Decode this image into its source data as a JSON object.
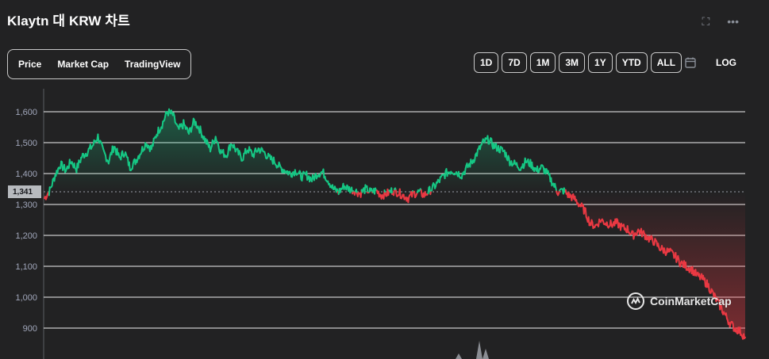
{
  "header": {
    "title": "Klaytn 대 KRW 차트",
    "fullscreen_icon": "expand-icon",
    "more_icon": "more-dots-icon"
  },
  "tabs": [
    {
      "label": "Price"
    },
    {
      "label": "Market Cap"
    },
    {
      "label": "TradingView"
    }
  ],
  "ranges": [
    "1D",
    "7D",
    "1M",
    "3M",
    "1Y",
    "YTD",
    "ALL"
  ],
  "calendar_icon": "calendar-icon",
  "log_label": "LOG",
  "current_price_label": "1,341",
  "watermark": "CoinMarketCap",
  "colors": {
    "up": "#16c784",
    "down": "#ea3943",
    "background": "#222223",
    "grid": "#ffffff"
  },
  "chart_data": {
    "type": "line",
    "title": "",
    "xlabel": "",
    "ylabel": "",
    "ylim": [
      850,
      1680
    ],
    "y_ticks": [
      900,
      1000,
      1100,
      1200,
      1300,
      1400,
      1500,
      1600
    ],
    "y_tick_labels": [
      "900",
      "1,000",
      "1,100",
      "1,200",
      "1,300",
      "1,400",
      "1,500",
      "1,600"
    ],
    "reference_price": 1341,
    "series": [
      {
        "values": [
          1320,
          1345,
          1395,
          1430,
          1410,
          1440,
          1415,
          1455,
          1470,
          1490,
          1520,
          1470,
          1440,
          1490,
          1450,
          1470,
          1420,
          1440,
          1470,
          1500,
          1480,
          1530,
          1560,
          1600,
          1590,
          1540,
          1560,
          1530,
          1570,
          1545,
          1510,
          1480,
          1520,
          1470,
          1460,
          1500,
          1470,
          1450,
          1480,
          1460,
          1480,
          1470,
          1450,
          1440,
          1420,
          1410,
          1400,
          1410,
          1390,
          1395,
          1380,
          1400,
          1405,
          1380,
          1350,
          1340,
          1360,
          1350,
          1345,
          1335,
          1350,
          1340,
          1345,
          1330,
          1335,
          1345,
          1340,
          1330,
          1320,
          1335,
          1340,
          1330,
          1345,
          1360,
          1380,
          1400,
          1410,
          1405,
          1395,
          1420,
          1440,
          1470,
          1500,
          1510,
          1490,
          1480,
          1470,
          1440,
          1430,
          1420,
          1440,
          1430,
          1410,
          1420,
          1400,
          1370,
          1340,
          1345,
          1330,
          1320,
          1300,
          1280,
          1240,
          1230,
          1250,
          1240,
          1235,
          1240,
          1225,
          1220,
          1200,
          1215,
          1205,
          1190,
          1180,
          1160,
          1150,
          1145,
          1130,
          1110,
          1100,
          1090,
          1070,
          1060,
          1040,
          1010,
          980,
          950,
          920,
          900,
          890,
          870
        ]
      }
    ],
    "grid": true,
    "legend": "none"
  }
}
